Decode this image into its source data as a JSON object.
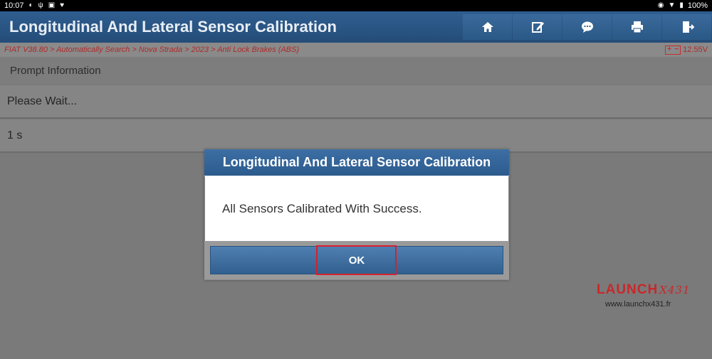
{
  "statusbar": {
    "time": "10:07",
    "battery": "100%"
  },
  "app": {
    "title": "Longitudinal And Lateral Sensor Calibration"
  },
  "toolbar": {
    "buttons": [
      {
        "icon": "home-icon"
      },
      {
        "icon": "edit-icon"
      },
      {
        "icon": "chat-icon"
      },
      {
        "icon": "print-icon"
      },
      {
        "icon": "exit-icon"
      }
    ]
  },
  "breadcrumb": {
    "path": "FIAT V38.80 > Automatically Search > Nova Strada > 2023 > Anti Lock Brakes (ABS)",
    "voltage": "12.55V"
  },
  "content": {
    "section_header": "Prompt Information",
    "rows": [
      "Please Wait...",
      "1 s"
    ]
  },
  "dialog": {
    "title": "Longitudinal And Lateral Sensor Calibration",
    "message": "All Sensors Calibrated With Success.",
    "ok_label": "OK"
  },
  "watermark": {
    "brand": "LAUNCH",
    "brand_suffix": "X431",
    "url": "www.launchx431.fr"
  },
  "colors": {
    "title_bar": "#2a5684",
    "highlight": "#d8202c",
    "breadcrumb_text": "#b02a2a"
  }
}
